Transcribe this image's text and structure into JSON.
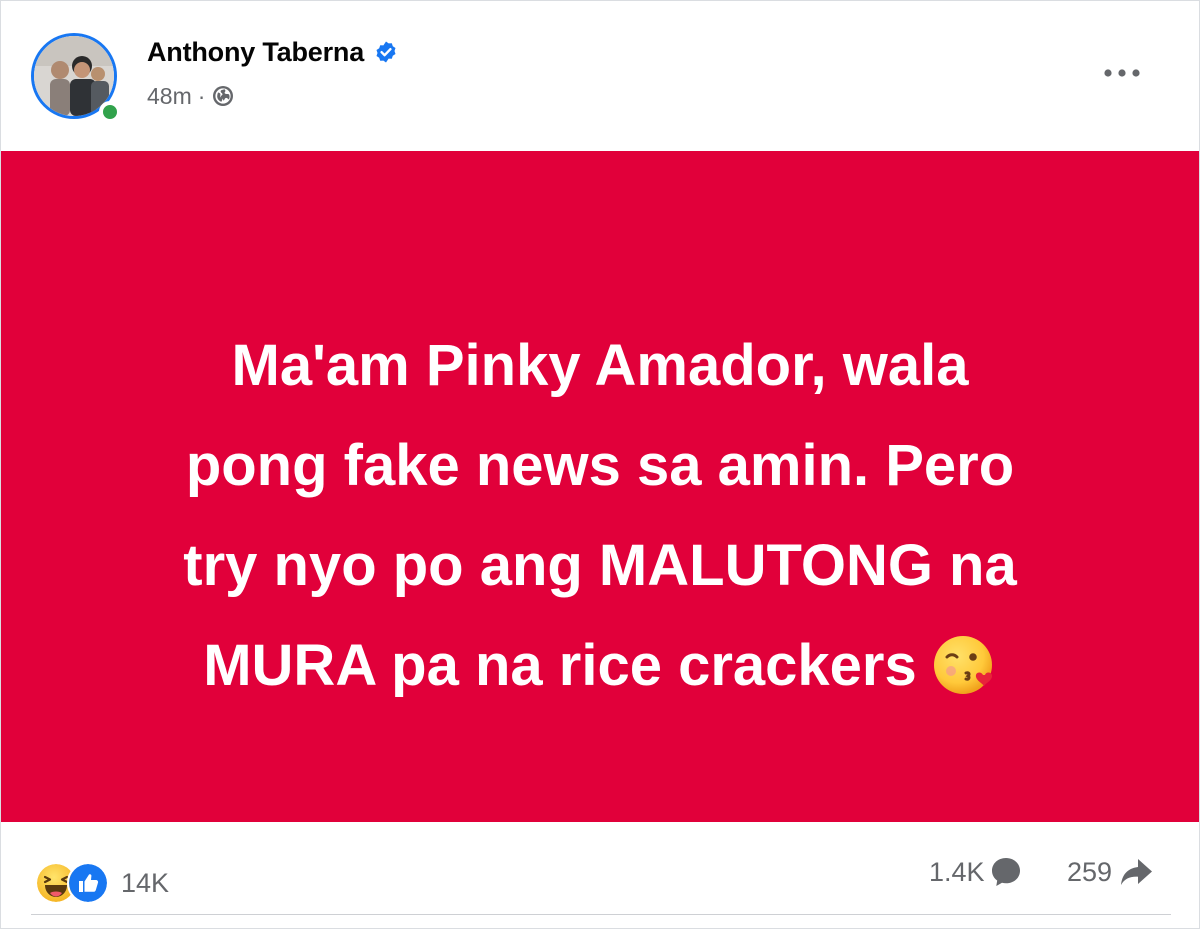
{
  "post": {
    "author_name": "Anthony Taberna",
    "timestamp": "48m",
    "separator": "·",
    "audience_icon": "globe-icon",
    "verified_icon": "verified-badge-icon",
    "more_icon": "more-options-icon",
    "background_color": "#e1003a",
    "text_lines": [
      "Ma'am Pinky Amador, wala",
      "pong fake news sa amin. Pero",
      "try nyo po ang MALUTONG na",
      "MURA pa na rice crackers"
    ],
    "trailing_emoji": "face-blowing-a-kiss-emoji"
  },
  "engagement": {
    "reaction_icons": [
      "haha-reaction-icon",
      "like-reaction-icon"
    ],
    "reaction_count": "14K",
    "comment_count": "1.4K",
    "comment_icon": "comment-icon",
    "share_count": "259",
    "share_icon": "share-icon"
  },
  "colors": {
    "accent": "#1877f2",
    "online": "#31a24c",
    "secondary_text": "#65676b"
  }
}
